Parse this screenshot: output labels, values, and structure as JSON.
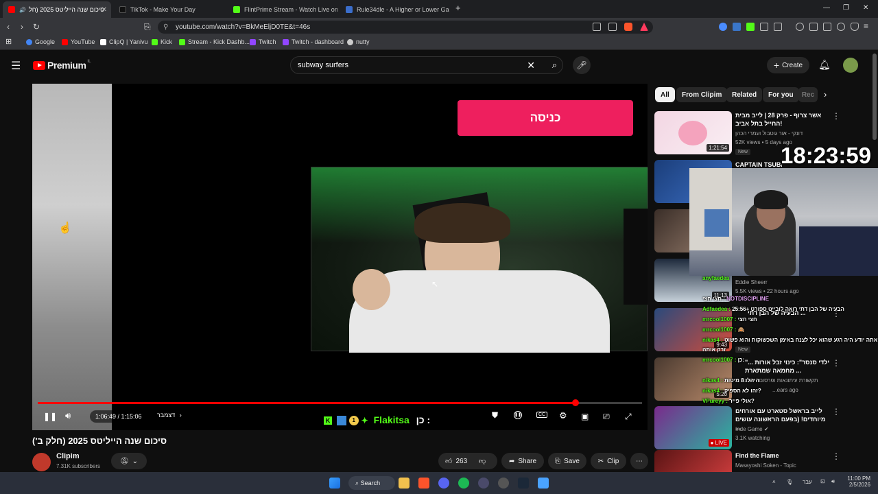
{
  "browser": {
    "tabs": [
      {
        "label": "סיכום שנה הייליטס 2025 (חל",
        "favicon_color": "#ff0000",
        "active": true
      },
      {
        "label": "TikTok - Make Your Day",
        "favicon_color": "#111111"
      },
      {
        "label": "FlintPrime Stream - Watch Live on K",
        "favicon_color": "#53fc18"
      },
      {
        "label": "Rule34dle - A Higher or Lower Ga",
        "favicon_color": "#3b6ecc"
      }
    ],
    "url": "youtube.com/watch?v=BkMeEljD0TE&t=46s",
    "bookmarks": [
      {
        "label": "Google",
        "color": "#4285f4"
      },
      {
        "label": "YouTube",
        "color": "#ff0000"
      },
      {
        "label": "ClipQ | Yanivu",
        "color": "#ffffff"
      },
      {
        "label": "Kick",
        "color": "#53fc18"
      },
      {
        "label": "Stream - Kick Dashb...",
        "color": "#53fc18"
      },
      {
        "label": "Twitch",
        "color": "#9146ff"
      },
      {
        "label": "Twitch - dashboard",
        "color": "#9146ff"
      },
      {
        "label": "nutty",
        "color": "#cccccc"
      }
    ]
  },
  "youtube": {
    "logo": "Premium",
    "logo_region": "IL",
    "search_query": "subway surfers",
    "create_label": "Create"
  },
  "player": {
    "enter_button": "כניסה",
    "time_current": "1:06:49",
    "time_total": "1:15:06",
    "time_display": "1:06:49 / 1:15:06",
    "chapter": "דצמבר",
    "progress": 0.89,
    "overlay_name": "Flakitsa",
    "overlay_prefix": "כן :",
    "badge_number": "1"
  },
  "overlay": {
    "clock": "18:23:59",
    "chat": [
      {
        "user": "anyfaedea",
        "text": ""
      },
      {
        "user": "חצי חצי :",
        "text": "NOTDISCIPLINE"
      },
      {
        "user": "Adfaedea :",
        "text": "25:56+ הבעיה של הבן דתי רואה לובייט ספורט"
      },
      {
        "user": "mrcool1007 :",
        "text": "חצי חצי"
      },
      {
        "user": "mrcool1007 :",
        "text": "🙈"
      },
      {
        "user": "nikas4 :",
        "text": "אתה יודע היה רגע שהוא יכל לצנח באימן השכשוקות והוא פשוט"
      },
      {
        "user": "",
        "text": "זרק אותה"
      },
      {
        "user": "mrcool1007 :",
        "text": "כן:"
      },
      {
        "user": "nikas4 :",
        "text": "היהלו 8 מיטות"
      },
      {
        "user": "nikas4 :",
        "text": "זהו לא הספיק?"
      },
      {
        "user": "VPureyy :",
        "text": "אולי פייר?"
      }
    ]
  },
  "video": {
    "title": "סיכום שנה הייליטס 2025 (חלק ב')",
    "channel": "Clipim",
    "subscribers": "7.31K subscribers",
    "likes": "263",
    "share": "Share",
    "save": "Save",
    "clip": "Clip"
  },
  "sidebar": {
    "chips": [
      "All",
      "From Clipim",
      "Related",
      "For you",
      "Rec"
    ],
    "items": [
      {
        "title": "אשר צרוף - פרק 28 | לייב מבית החייל בתל אביב!",
        "channel": "דונקי - אור גוטבול ועמרי הכהן",
        "meta": "52K views • 5 days ago",
        "badge": "New",
        "duration": "1:21:54"
      },
      {
        "title": "CAPTAIN TSUBASA 2: World...",
        "channel": "",
        "meta": "",
        "badge": "",
        "duration": ""
      },
      {
        "title": "",
        "channel": "",
        "meta": "",
        "badge": "",
        "duration": ""
      },
      {
        "title": "",
        "channel": "Eddie Sheerr",
        "meta": "5.5K views • 22 hours ago",
        "badge": "",
        "duration": "11:13"
      },
      {
        "title": "הבעיה של הבן דתי ...",
        "channel": "",
        "meta": "",
        "badge": "New",
        "duration": "9:43"
      },
      {
        "title": "\"ילדי סנסר\": כינוי זבל אורות ... מחמאה שמתארת ...",
        "channel": "תקשורת עיתונאות ופרסום - אורנה",
        "meta": "...ears ago",
        "badge": "",
        "duration": "5:20"
      },
      {
        "title": "לייב בראשל סטארט עם אורחים מיוחדים! (בפעם הראשונה עושים ...",
        "channel": "Inde Game",
        "meta": "3.1K watching",
        "badge": "LIVE",
        "duration": ""
      },
      {
        "title": "Find the Flame",
        "channel": "Masayoshi Soken - Topic",
        "meta": "",
        "badge": "",
        "duration": ""
      }
    ]
  },
  "taskbar": {
    "search": "Search",
    "lang": "עבר",
    "time": "11:00 PM",
    "date": "2/5/2026"
  }
}
